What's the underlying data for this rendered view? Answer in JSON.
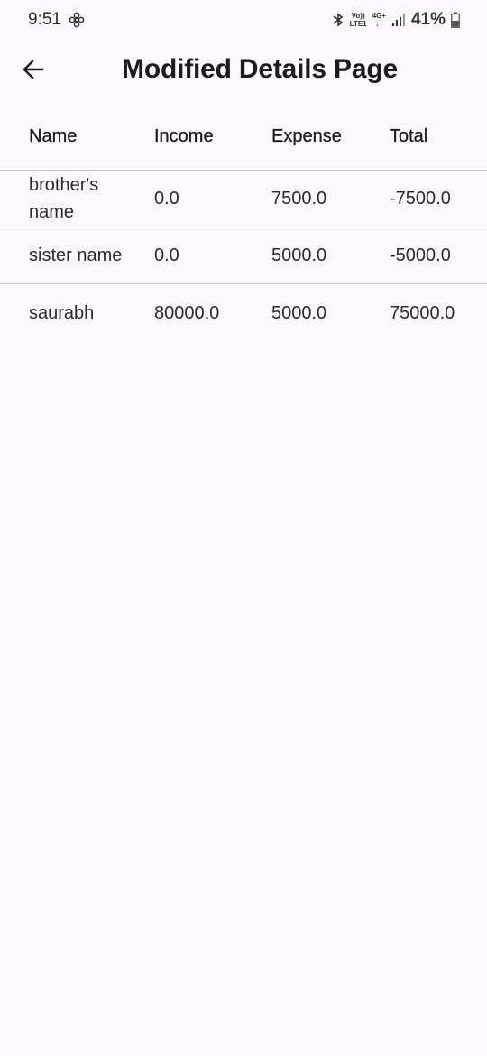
{
  "status_bar": {
    "time": "9:51",
    "network_top": "Vo))",
    "network_bottom": "LTE1",
    "signal_top": "4G+",
    "signal_bottom": "↓↑",
    "battery": "41%"
  },
  "app_bar": {
    "title": "Modified Details Page"
  },
  "table": {
    "headers": [
      "Name",
      "Income",
      "Expense",
      "Total"
    ],
    "rows": [
      {
        "name": "brother's name",
        "income": "0.0",
        "expense": "7500.0",
        "total": "-7500.0"
      },
      {
        "name": "sister name",
        "income": "0.0",
        "expense": "5000.0",
        "total": "-5000.0"
      },
      {
        "name": "saurabh",
        "income": "80000.0",
        "expense": "5000.0",
        "total": "75000.0"
      }
    ]
  }
}
